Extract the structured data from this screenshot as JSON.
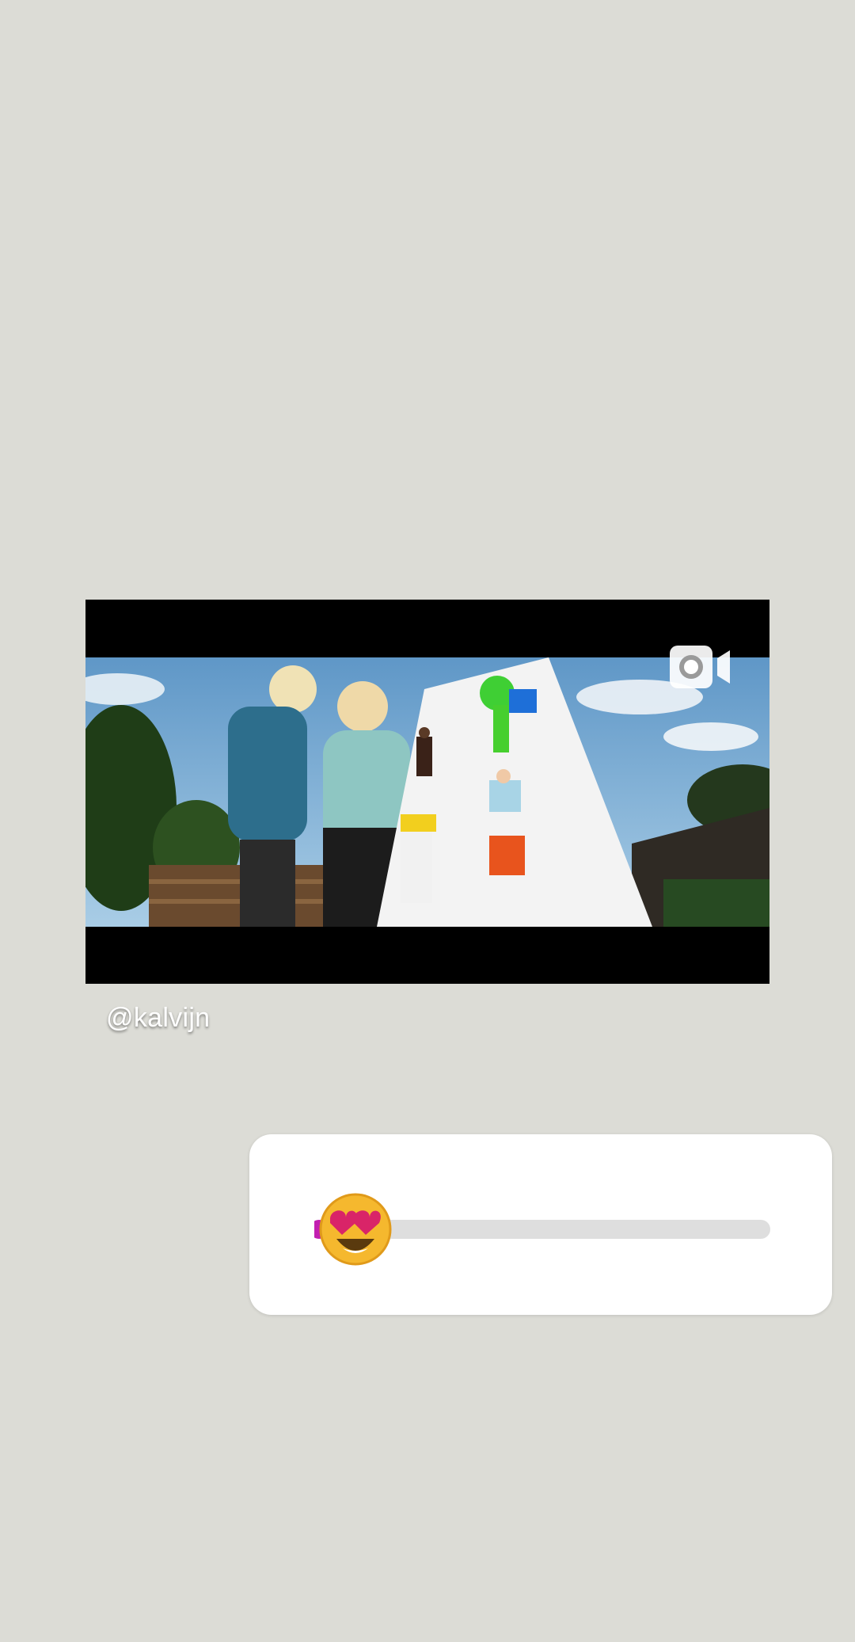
{
  "story": {
    "mention": "@kalvijn",
    "media_type_icon": "video-camera-icon"
  },
  "emoji_slider": {
    "emoji": "heart-eyes-emoji",
    "value": 0.0,
    "track_color": "#dedede",
    "fill_color": "#c21fb0"
  },
  "colors": {
    "background": "#dcdcd6",
    "card": "#ffffff"
  }
}
